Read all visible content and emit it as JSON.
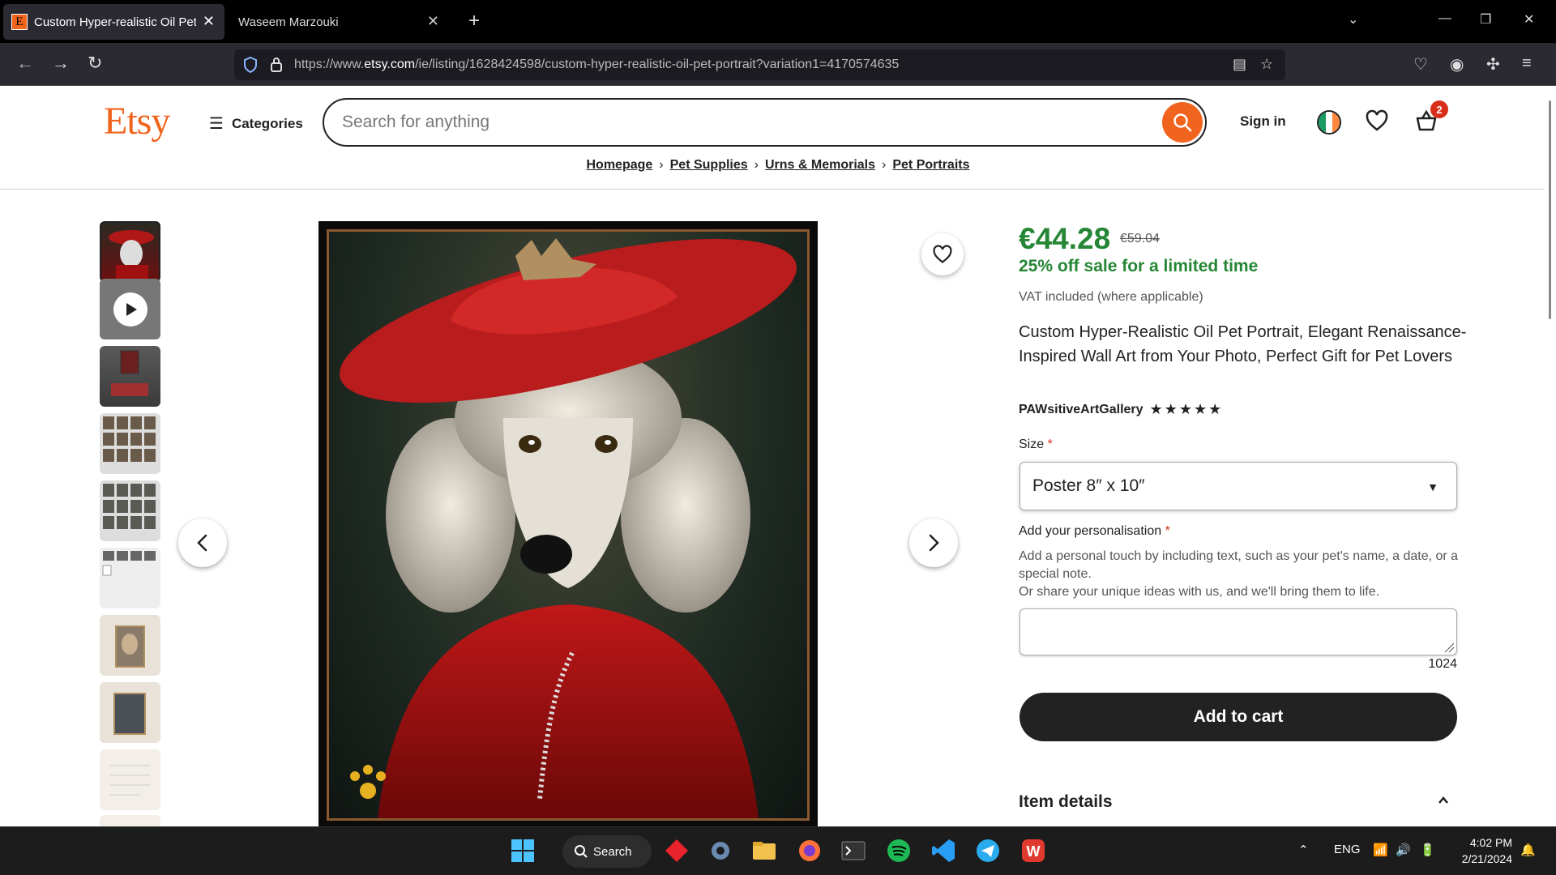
{
  "browser": {
    "tabs": [
      {
        "label": "Custom Hyper-realistic Oil Pet P",
        "favicon": "E"
      },
      {
        "label": "Waseem Marzouki"
      }
    ],
    "url_prefix": "https://www.",
    "url_domain": "etsy.com",
    "url_rest": "/ie/listing/1628424598/custom-hyper-realistic-oil-pet-portrait?variation1=4170574635"
  },
  "header": {
    "logo": "Etsy",
    "categories_label": "Categories",
    "search_placeholder": "Search for anything",
    "signin_label": "Sign in",
    "cart_count": "2"
  },
  "breadcrumb": [
    "Homepage",
    "Pet Supplies",
    "Urns & Memorials",
    "Pet Portraits"
  ],
  "listing": {
    "price": "€44.28",
    "old_price": "€59.04",
    "sale_text": "25% off sale for a limited time",
    "vat_text": "VAT included (where applicable)",
    "title": "Custom Hyper-Realistic Oil Pet Portrait, Elegant Renaissance-Inspired Wall Art from Your Photo, Perfect Gift for Pet Lovers",
    "shop_name": "PAWsitiveArtGallery",
    "rating_stars": "★★★★★",
    "size_label": "Size",
    "size_value": "Poster 8″ x 10″",
    "personalisation_label": "Add your personalisation",
    "personalisation_help_1": "Add a personal touch by including text, such as your pet's name, a date, or a special note.",
    "personalisation_help_2": "Or share your unique ideas with us, and we'll bring them to life.",
    "char_count": "1024",
    "add_to_cart": "Add to cart",
    "item_details": "Item details"
  },
  "taskbar": {
    "search_label": "Search",
    "lang": "ENG",
    "time": "4:02 PM",
    "date": "2/21/2024"
  },
  "colors": {
    "etsy_orange": "#f1641e",
    "sale_green": "#258635"
  }
}
